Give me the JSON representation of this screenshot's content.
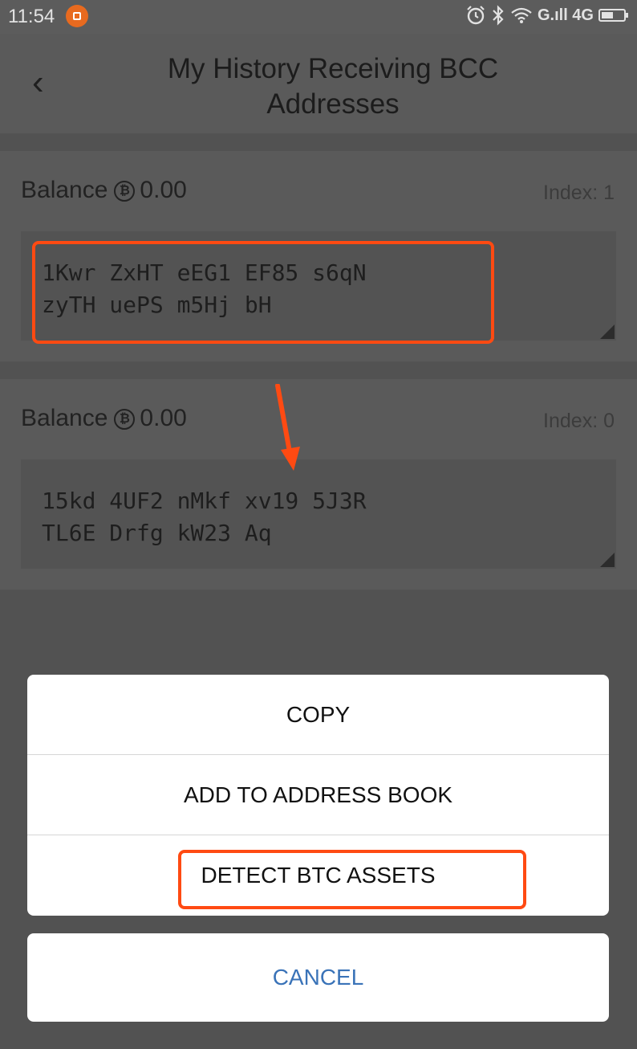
{
  "status_bar": {
    "time": "11:54",
    "right_text": "G.ıll 4G",
    "icons": [
      "alarm-icon",
      "bluetooth-icon",
      "wifi-icon",
      "signal-icon",
      "battery-icon"
    ]
  },
  "header": {
    "back_glyph": "‹",
    "title": "My History Receiving BCC Addresses"
  },
  "addresses": [
    {
      "balance_label": "Balance",
      "coin_glyph": "₿",
      "balance": "0.00",
      "index": "Index: 1",
      "line1": "1Kwr ZxHT eEG1 EF85 s6qN",
      "line2": "zyTH uePS m5Hj bH"
    },
    {
      "balance_label": "Balance",
      "coin_glyph": "₿",
      "balance": "0.00",
      "index": "Index: 0",
      "line1": "15kd 4UF2 nMkf xv19 5J3R",
      "line2": "TL6E Drfg kW23 Aq"
    }
  ],
  "sheet": {
    "copy": "COPY",
    "add_to_address_book": "ADD TO ADDRESS BOOK",
    "detect_btc_assets": "DETECT BTC ASSETS",
    "cancel": "CANCEL"
  },
  "colors": {
    "highlight": "#ff4a12",
    "cancel_text": "#3a73b8",
    "overlay_bg": "#525252"
  }
}
